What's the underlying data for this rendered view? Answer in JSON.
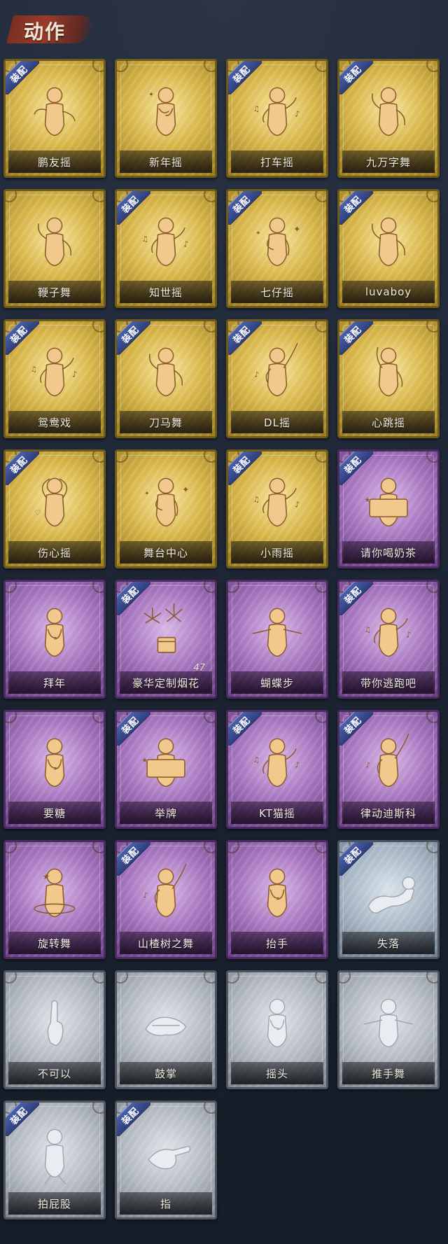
{
  "header": {
    "title": "动作"
  },
  "badge_label": "装配",
  "colors": {
    "gold": "#d7b548",
    "purple": "#a878c0",
    "silver": "#b3b9c1",
    "steel": "#a7b6c4",
    "badge": "#3a4d92"
  },
  "emotes": [
    {
      "name": "鹏友摇",
      "tier": "gold",
      "equipped": true,
      "icon": "figure-shaking-icon"
    },
    {
      "name": "新年摇",
      "tier": "gold",
      "equipped": false,
      "icon": "figure-clapping-icon"
    },
    {
      "name": "打车摇",
      "tier": "gold",
      "equipped": true,
      "icon": "figure-music-icon"
    },
    {
      "name": "九万字舞",
      "tier": "gold",
      "equipped": true,
      "icon": "figure-dance-icon"
    },
    {
      "name": "鞭子舞",
      "tier": "gold",
      "equipped": false,
      "icon": "figure-dance-icon"
    },
    {
      "name": "知世摇",
      "tier": "gold",
      "equipped": true,
      "icon": "figure-music-icon"
    },
    {
      "name": "七仔摇",
      "tier": "gold",
      "equipped": true,
      "icon": "figure-sparkle-icon"
    },
    {
      "name": "luvaboy",
      "tier": "gold",
      "equipped": true,
      "icon": "figure-dance-icon"
    },
    {
      "name": "鸳鸯戏",
      "tier": "gold",
      "equipped": true,
      "icon": "figure-music-icon"
    },
    {
      "name": "刀马舞",
      "tier": "gold",
      "equipped": true,
      "icon": "figure-dance-icon"
    },
    {
      "name": "DL摇",
      "tier": "gold",
      "equipped": true,
      "icon": "figure-arm-up-icon"
    },
    {
      "name": "心跳摇",
      "tier": "gold",
      "equipped": true,
      "icon": "figure-wave-icon"
    },
    {
      "name": "伤心摇",
      "tier": "gold",
      "equipped": true,
      "icon": "figure-heart-icon"
    },
    {
      "name": "舞台中心",
      "tier": "gold",
      "equipped": false,
      "icon": "figure-sparkle-icon"
    },
    {
      "name": "小雨摇",
      "tier": "gold",
      "equipped": true,
      "icon": "figure-music-icon"
    },
    {
      "name": "请你喝奶茶",
      "tier": "purple",
      "equipped": true,
      "icon": "figure-sign-icon"
    },
    {
      "name": "拜年",
      "tier": "purple",
      "equipped": false,
      "icon": "figure-bow-icon"
    },
    {
      "name": "豪华定制烟花",
      "tier": "purple",
      "equipped": true,
      "icon": "fireworks-icon",
      "count": "47"
    },
    {
      "name": "蝴蝶步",
      "tier": "purple",
      "equipped": false,
      "icon": "figure-point-icon"
    },
    {
      "name": "带你逃跑吧",
      "tier": "purple",
      "equipped": true,
      "icon": "figure-music-icon"
    },
    {
      "name": "要糖",
      "tier": "purple",
      "equipped": false,
      "icon": "figure-bow-icon"
    },
    {
      "name": "举牌",
      "tier": "purple",
      "equipped": true,
      "icon": "figure-sign-icon"
    },
    {
      "name": "KT猫摇",
      "tier": "purple",
      "equipped": true,
      "icon": "figure-music-icon"
    },
    {
      "name": "律动迪斯科",
      "tier": "purple",
      "equipped": true,
      "icon": "figure-arm-up-icon"
    },
    {
      "name": "旋转舞",
      "tier": "purple",
      "equipped": false,
      "icon": "figure-spin-icon"
    },
    {
      "name": "山楂树之舞",
      "tier": "purple",
      "equipped": true,
      "icon": "figure-arm-up-icon"
    },
    {
      "name": "抬手",
      "tier": "purple",
      "equipped": false,
      "icon": "figure-bow-icon"
    },
    {
      "name": "失落",
      "tier": "steel",
      "equipped": true,
      "icon": "figure-crawl-icon"
    },
    {
      "name": "不可以",
      "tier": "silver",
      "equipped": false,
      "icon": "finger-wag-icon"
    },
    {
      "name": "鼓掌",
      "tier": "silver",
      "equipped": false,
      "icon": "clapping-hands-icon"
    },
    {
      "name": "摇头",
      "tier": "silver",
      "equipped": false,
      "icon": "figure-bow-icon"
    },
    {
      "name": "推手舞",
      "tier": "silver",
      "equipped": false,
      "icon": "figure-point-icon"
    },
    {
      "name": "拍屁股",
      "tier": "silver",
      "equipped": true,
      "icon": "figure-walk-icon"
    },
    {
      "name": "指",
      "tier": "silver",
      "equipped": true,
      "icon": "pointing-hand-icon"
    }
  ]
}
